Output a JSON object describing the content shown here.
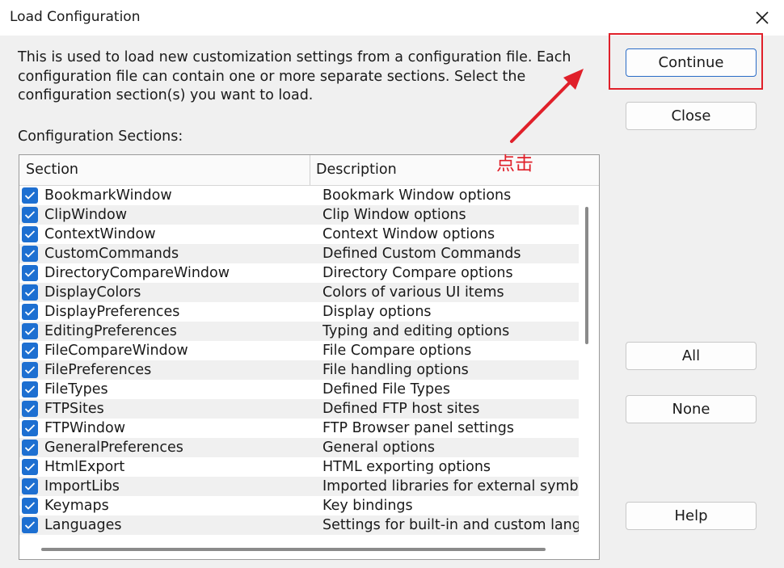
{
  "window": {
    "title": "Load Configuration"
  },
  "description": "This is used to load new customization settings from a configuration file. Each configuration file can contain one or more separate sections. Select the configuration section(s) you want to load.",
  "sections_label": "Configuration Sections:",
  "table": {
    "columns": [
      "Section",
      "Description"
    ],
    "rows": [
      {
        "name": "BookmarkWindow",
        "desc": "Bookmark Window options"
      },
      {
        "name": "ClipWindow",
        "desc": "Clip Window options"
      },
      {
        "name": "ContextWindow",
        "desc": "Context Window options"
      },
      {
        "name": "CustomCommands",
        "desc": "Defined Custom Commands"
      },
      {
        "name": "DirectoryCompareWindow",
        "desc": "Directory Compare options"
      },
      {
        "name": "DisplayColors",
        "desc": "Colors of various UI items"
      },
      {
        "name": "DisplayPreferences",
        "desc": "Display options"
      },
      {
        "name": "EditingPreferences",
        "desc": "Typing and editing options"
      },
      {
        "name": "FileCompareWindow",
        "desc": "File Compare options"
      },
      {
        "name": "FilePreferences",
        "desc": "File handling options"
      },
      {
        "name": "FileTypes",
        "desc": "Defined File Types"
      },
      {
        "name": "FTPSites",
        "desc": "Defined FTP host sites"
      },
      {
        "name": "FTPWindow",
        "desc": "FTP Browser panel settings"
      },
      {
        "name": "GeneralPreferences",
        "desc": "General options"
      },
      {
        "name": "HtmlExport",
        "desc": "HTML exporting options"
      },
      {
        "name": "ImportLibs",
        "desc": "Imported libraries for external symbo"
      },
      {
        "name": "Keymaps",
        "desc": "Key bindings"
      },
      {
        "name": "Languages",
        "desc": "Settings for built-in and custom lang"
      }
    ],
    "all_checked": true
  },
  "buttons": {
    "continue": "Continue",
    "close": "Close",
    "all": "All",
    "none": "None",
    "help": "Help"
  },
  "annotation": {
    "text": "点击",
    "color": "#e0202a"
  },
  "colors": {
    "checkbox": "#1d6fd1",
    "highlight": "#e0202a",
    "primary_border": "#2a6cc7"
  }
}
